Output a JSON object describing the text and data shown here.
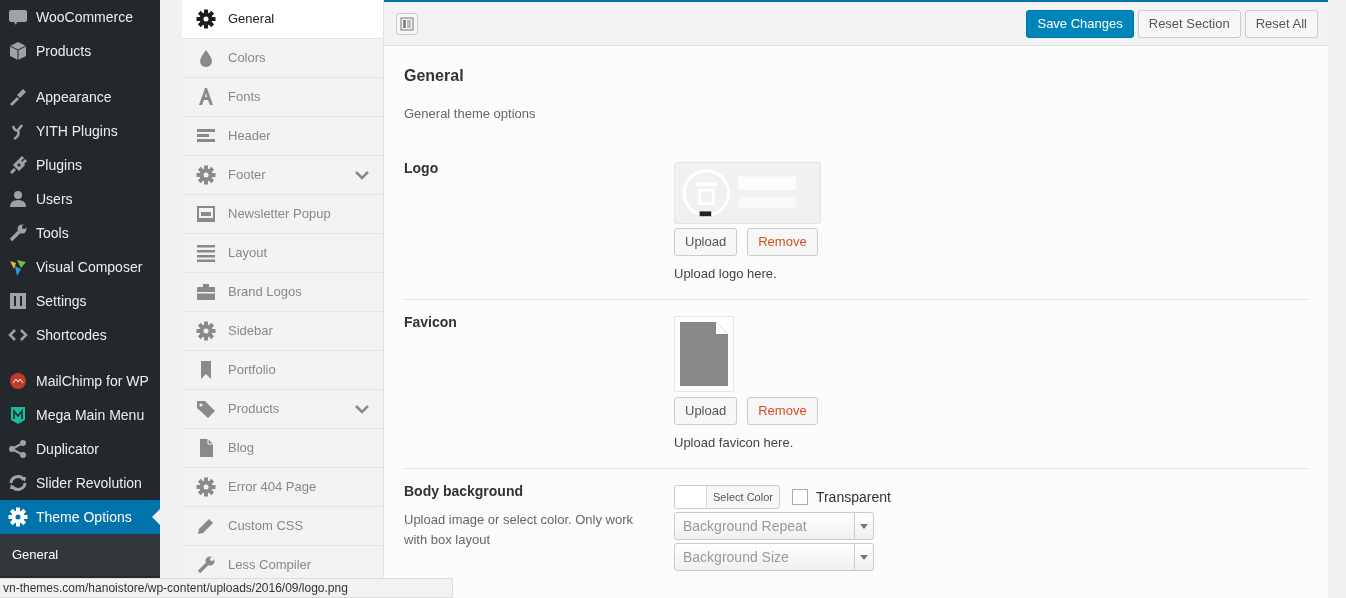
{
  "admin_menu": {
    "groups": [
      [
        {
          "label": "WooCommerce",
          "selected": false
        },
        {
          "label": "Products",
          "selected": false
        }
      ],
      [
        {
          "label": "Appearance",
          "selected": false
        },
        {
          "label": "YITH Plugins",
          "selected": false
        },
        {
          "label": "Plugins",
          "selected": false
        },
        {
          "label": "Users",
          "selected": false
        },
        {
          "label": "Tools",
          "selected": false
        },
        {
          "label": "Visual Composer",
          "selected": false
        },
        {
          "label": "Settings",
          "selected": false
        },
        {
          "label": "Shortcodes",
          "selected": false
        }
      ],
      [
        {
          "label": "MailChimp for WP",
          "selected": false
        },
        {
          "label": "Mega Main Menu",
          "selected": false
        },
        {
          "label": "Duplicator",
          "selected": false
        },
        {
          "label": "Slider Revolution",
          "selected": false
        },
        {
          "label": "Theme Options",
          "selected": true
        }
      ]
    ],
    "submenu": [
      {
        "label": "General",
        "selected": true
      }
    ]
  },
  "options_nav": [
    {
      "label": "General",
      "selected": true,
      "has_submenu": false
    },
    {
      "label": "Colors",
      "selected": false,
      "has_submenu": false
    },
    {
      "label": "Fonts",
      "selected": false,
      "has_submenu": false
    },
    {
      "label": "Header",
      "selected": false,
      "has_submenu": false
    },
    {
      "label": "Footer",
      "selected": false,
      "has_submenu": true
    },
    {
      "label": "Newsletter Popup",
      "selected": false,
      "has_submenu": false
    },
    {
      "label": "Layout",
      "selected": false,
      "has_submenu": false
    },
    {
      "label": "Brand Logos",
      "selected": false,
      "has_submenu": false
    },
    {
      "label": "Sidebar",
      "selected": false,
      "has_submenu": false
    },
    {
      "label": "Portfolio",
      "selected": false,
      "has_submenu": false
    },
    {
      "label": "Products",
      "selected": false,
      "has_submenu": true
    },
    {
      "label": "Blog",
      "selected": false,
      "has_submenu": false
    },
    {
      "label": "Error 404 Page",
      "selected": false,
      "has_submenu": false
    },
    {
      "label": "Custom CSS",
      "selected": false,
      "has_submenu": false
    },
    {
      "label": "Less Compiler",
      "selected": false,
      "has_submenu": false
    }
  ],
  "toolbar": {
    "buttons": [
      {
        "label": "Save Changes",
        "kind": "primary"
      },
      {
        "label": "Reset Section",
        "kind": "secondary"
      },
      {
        "label": "Reset All",
        "kind": "secondary"
      }
    ]
  },
  "section": {
    "title": "General",
    "description": "General theme options",
    "fields": [
      {
        "label": "Logo",
        "buttons": [
          {
            "label": "Upload",
            "kind": "secondary"
          },
          {
            "label": "Remove",
            "kind": "danger"
          }
        ],
        "description": "Upload logo here."
      },
      {
        "kind": "file",
        "label": "Favicon",
        "buttons": [
          {
            "label": "Upload",
            "kind": "secondary"
          },
          {
            "label": "Remove",
            "kind": "danger"
          }
        ],
        "description": "Upload favicon here."
      },
      {
        "kind": "background",
        "label": "Body background",
        "description": "Upload image or select color. Only work with box layout",
        "color_button": "Select Color",
        "transparent": {
          "label": "Transparent",
          "checked": false
        },
        "selects": [
          {
            "placeholder": "Background Repeat"
          },
          {
            "placeholder": "Background Size"
          }
        ]
      }
    ]
  },
  "status_bar": {
    "url": "vn-themes.com/hanoistore/wp-content/uploads/2016/09/logo.png"
  }
}
